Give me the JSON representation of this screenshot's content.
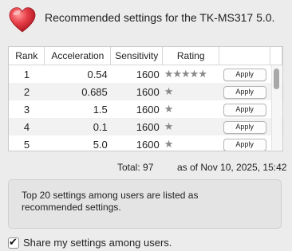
{
  "header": {
    "title": "Recommended settings for the TK-MS317 5.0.",
    "icon": "heart-icon",
    "icon_color": "#e0303c"
  },
  "table": {
    "columns": [
      "Rank",
      "Acceleration",
      "Sensitivity",
      "Rating",
      ""
    ],
    "rows": [
      {
        "rank": "1",
        "acceleration": "0.54",
        "sensitivity": "1600",
        "rating": "★★★★★",
        "rating_stars": 5,
        "apply": "Apply"
      },
      {
        "rank": "2",
        "acceleration": "0.685",
        "sensitivity": "1600",
        "rating": "★",
        "rating_stars": 1,
        "apply": "Apply"
      },
      {
        "rank": "3",
        "acceleration": "1.5",
        "sensitivity": "1600",
        "rating": "★",
        "rating_stars": 1,
        "apply": "Apply"
      },
      {
        "rank": "4",
        "acceleration": "0.1",
        "sensitivity": "1600",
        "rating": "★",
        "rating_stars": 1,
        "apply": "Apply"
      },
      {
        "rank": "5",
        "acceleration": "5.0",
        "sensitivity": "1600",
        "rating": "★",
        "rating_stars": 1,
        "apply": "Apply"
      }
    ]
  },
  "summary": {
    "total": "Total: 97",
    "as_of": "as of Nov 10, 2025, 15:42"
  },
  "info": {
    "text": "Top 20 settings among users are listed as recommended settings."
  },
  "share": {
    "label": "Share my settings among users.",
    "checked": true
  }
}
